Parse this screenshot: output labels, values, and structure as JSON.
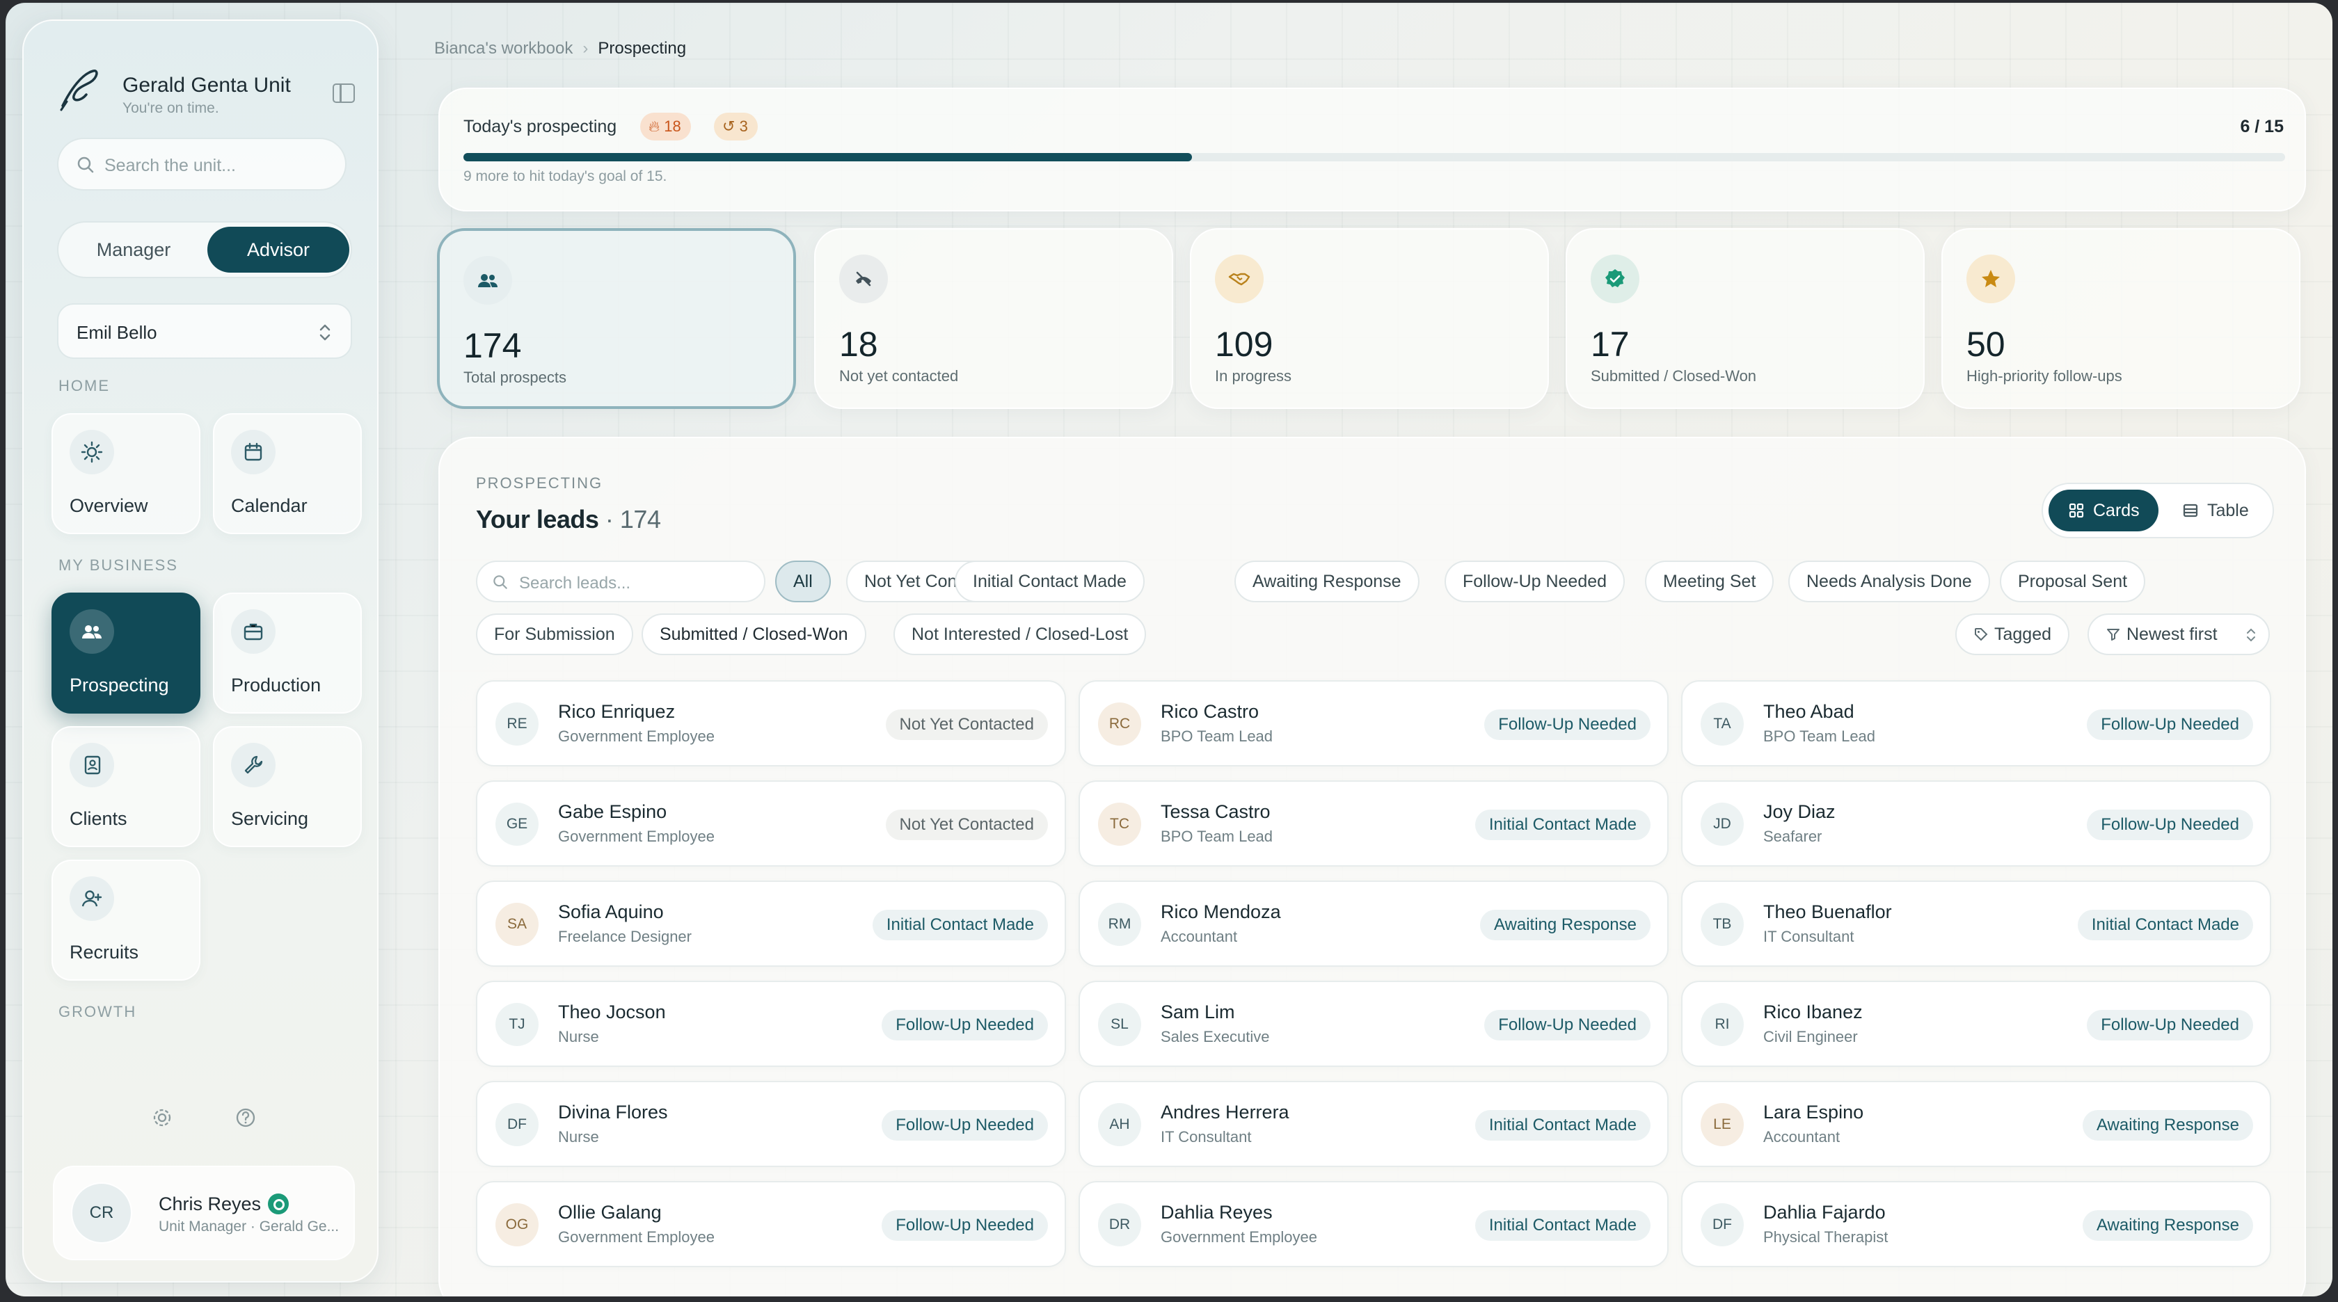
{
  "brand": {
    "name": "Gerald Genta Unit",
    "subtitle": "You're on time."
  },
  "sidebar": {
    "search_placeholder": "Search the unit...",
    "roles": [
      "Manager",
      "Advisor"
    ],
    "active_role": "Advisor",
    "selected_person": "Emil Bello",
    "sections": {
      "home": "HOME",
      "business": "MY BUSINESS",
      "growth": "GROWTH"
    },
    "home_items": [
      {
        "label": "Overview",
        "icon": "sun-icon"
      },
      {
        "label": "Calendar",
        "icon": "calendar-icon"
      }
    ],
    "business_items": [
      {
        "label": "Prospecting",
        "icon": "people-icon",
        "active": true
      },
      {
        "label": "Production",
        "icon": "briefcase-icon"
      },
      {
        "label": "Clients",
        "icon": "contact-book-icon"
      },
      {
        "label": "Servicing",
        "icon": "wrench-icon"
      },
      {
        "label": "Recruits",
        "icon": "add-user-icon"
      }
    ],
    "user": {
      "initials": "CR",
      "name": "Chris Reyes",
      "role": "Unit Manager · Gerald Ge..."
    }
  },
  "breadcrumb": {
    "parent": "Bianca's workbook",
    "current": "Prospecting"
  },
  "goal": {
    "title": "Today's prospecting",
    "fire_count": "18",
    "followup_count": "3",
    "done": 6,
    "total": 15,
    "count_label": "6 / 15",
    "hint": "9 more to hit today's goal of 15."
  },
  "stats": [
    {
      "value": "174",
      "label": "Total prospects",
      "icon": "people-icon",
      "color": "#1c5a66",
      "bg": "#e6eeef"
    },
    {
      "value": "18",
      "label": "Not yet contacted",
      "icon": "phone-off-icon",
      "color": "#43525a",
      "bg": "#e9ecec"
    },
    {
      "value": "109",
      "label": "In progress",
      "icon": "handshake-icon",
      "color": "#b9821c",
      "bg": "#f8ead0"
    },
    {
      "value": "17",
      "label": "Submitted / Closed-Won",
      "icon": "check-badge-icon",
      "color": "#1b9a78",
      "bg": "#dfeee8"
    },
    {
      "value": "50",
      "label": "High-priority follow-ups",
      "icon": "star-icon",
      "color": "#c98a12",
      "bg": "#f8ead0"
    }
  ],
  "leads": {
    "kicker": "PROSPECTING",
    "title": "Your leads",
    "count": "· 174",
    "view": {
      "cards": "Cards",
      "table": "Table"
    },
    "search_placeholder": "Search leads...",
    "filters": [
      "All",
      "Not Yet Contacted",
      "Initial Contact Made",
      "Awaiting Response",
      "Follow-Up Needed",
      "Meeting Set",
      "Needs Analysis Done",
      "Proposal Sent",
      "For Submission",
      "Submitted / Closed-Won",
      "Not Interested / Closed-Lost"
    ],
    "active_filter": "All",
    "tagged": "Tagged",
    "sort": "Newest first",
    "cards": [
      {
        "initials": "RE",
        "name": "Rico Enriquez",
        "job": "Government Employee",
        "status": "Not Yet Contacted"
      },
      {
        "initials": "RC",
        "name": "Rico Castro",
        "job": "BPO Team Lead",
        "status": "Follow-Up Needed"
      },
      {
        "initials": "TA",
        "name": "Theo Abad",
        "job": "BPO Team Lead",
        "status": "Follow-Up Needed"
      },
      {
        "initials": "GE",
        "name": "Gabe Espino",
        "job": "Government Employee",
        "status": "Not Yet Contacted"
      },
      {
        "initials": "TC",
        "name": "Tessa Castro",
        "job": "BPO Team Lead",
        "status": "Initial Contact Made"
      },
      {
        "initials": "JD",
        "name": "Joy Diaz",
        "job": "Seafarer",
        "status": "Follow-Up Needed"
      },
      {
        "initials": "SA",
        "name": "Sofia Aquino",
        "job": "Freelance Designer",
        "status": "Initial Contact Made"
      },
      {
        "initials": "RM",
        "name": "Rico Mendoza",
        "job": "Accountant",
        "status": "Awaiting Response"
      },
      {
        "initials": "TB",
        "name": "Theo Buenaflor",
        "job": "IT Consultant",
        "status": "Initial Contact Made"
      },
      {
        "initials": "TJ",
        "name": "Theo Jocson",
        "job": "Nurse",
        "status": "Follow-Up Needed"
      },
      {
        "initials": "SL",
        "name": "Sam Lim",
        "job": "Sales Executive",
        "status": "Follow-Up Needed"
      },
      {
        "initials": "RI",
        "name": "Rico Ibanez",
        "job": "Civil Engineer",
        "status": "Follow-Up Needed"
      },
      {
        "initials": "DF",
        "name": "Divina Flores",
        "job": "Nurse",
        "status": "Follow-Up Needed"
      },
      {
        "initials": "AH",
        "name": "Andres Herrera",
        "job": "IT Consultant",
        "status": "Initial Contact Made"
      },
      {
        "initials": "LE",
        "name": "Lara Espino",
        "job": "Accountant",
        "status": "Awaiting Response"
      },
      {
        "initials": "OG",
        "name": "Ollie Galang",
        "job": "Government Employee",
        "status": "Follow-Up Needed"
      },
      {
        "initials": "DR",
        "name": "Dahlia Reyes",
        "job": "Government Employee",
        "status": "Initial Contact Made"
      },
      {
        "initials": "DF",
        "name": "Dahlia Fajardo",
        "job": "Physical Therapist",
        "status": "Awaiting Response"
      }
    ]
  }
}
